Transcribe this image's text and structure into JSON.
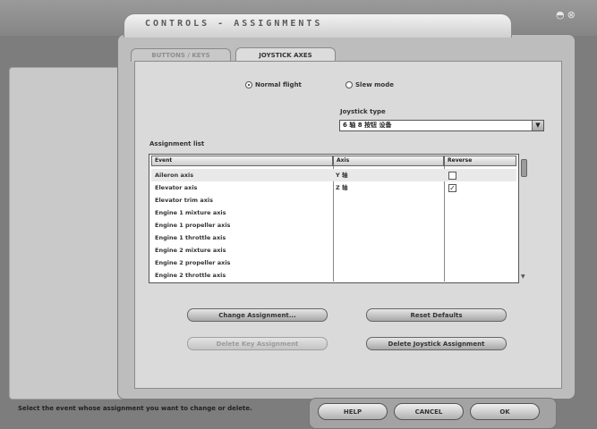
{
  "window": {
    "title": "CONTROLS - ASSIGNMENTS",
    "controls": [
      "◓",
      "⊗"
    ]
  },
  "tabs": [
    {
      "label": "BUTTONS / KEYS",
      "active": false
    },
    {
      "label": "JOYSTICK AXES",
      "active": true
    }
  ],
  "mode": {
    "options": [
      {
        "label": "Normal flight",
        "selected": true
      },
      {
        "label": "Slew mode",
        "selected": false
      }
    ]
  },
  "joystick_type": {
    "label": "Joystick type",
    "value": "6 轴 8 按钮 设备"
  },
  "assignment_list": {
    "label": "Assignment list",
    "columns": [
      "Event",
      "Axis",
      "Reverse"
    ],
    "rows": [
      {
        "event": "Aileron axis",
        "axis": "Y 轴",
        "reverse": false
      },
      {
        "event": "Elevator axis",
        "axis": "Z 轴",
        "reverse": true
      },
      {
        "event": "Elevator trim axis",
        "axis": "",
        "reverse": null
      },
      {
        "event": "Engine 1 mixture axis",
        "axis": "",
        "reverse": null
      },
      {
        "event": "Engine 1 propeller axis",
        "axis": "",
        "reverse": null
      },
      {
        "event": "Engine 1 throttle axis",
        "axis": "",
        "reverse": null
      },
      {
        "event": "Engine 2 mixture axis",
        "axis": "",
        "reverse": null
      },
      {
        "event": "Engine 2 propeller axis",
        "axis": "",
        "reverse": null
      },
      {
        "event": "Engine 2 throttle axis",
        "axis": "",
        "reverse": null
      }
    ]
  },
  "buttons": {
    "change": "Change Assignment...",
    "reset": "Reset Defaults",
    "delete_key": "Delete Key Assignment",
    "delete_joystick": "Delete Joystick Assignment"
  },
  "status_text": "Select the event whose assignment you want to change or delete.",
  "dialog_buttons": {
    "help": "HELP",
    "cancel": "CANCEL",
    "ok": "OK"
  },
  "colors": {
    "background": "#7d7d7d",
    "panel": "#dadada",
    "frame": "#bdbdbd"
  }
}
